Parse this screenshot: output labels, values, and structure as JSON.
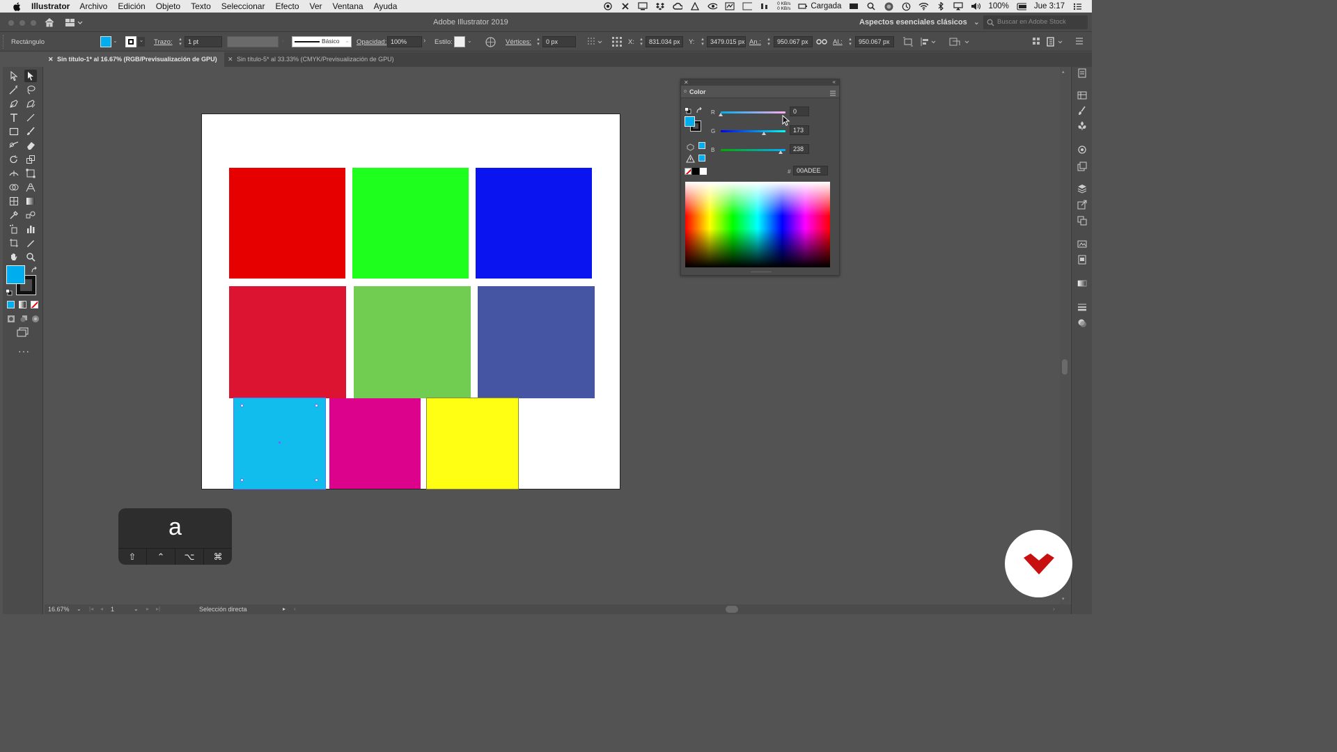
{
  "menubar": {
    "app_name": "Illustrator",
    "items": [
      "Archivo",
      "Edición",
      "Objeto",
      "Texto",
      "Seleccionar",
      "Efecto",
      "Ver",
      "Ventana",
      "Ayuda"
    ],
    "net_up": "0 KB/s",
    "net_down": "0 KB/s",
    "battery_status": "Cargada",
    "battery_pct": "100%",
    "clock": "Jue 3:17"
  },
  "titlebar": {
    "window_title": "Adobe Illustrator 2019",
    "workspace": "Aspectos esenciales clásicos",
    "stock_search_placeholder": "Buscar en Adobe Stock"
  },
  "controlbar": {
    "object_type": "Rectángulo",
    "stroke_label": "Trazo:",
    "stroke_value": "1 pt",
    "brush_label": "Básico",
    "opacity_label": "Opacidad:",
    "opacity_value": "100%",
    "style_label": "Estilo:",
    "vertices_label": "Vértices:",
    "vertices_value": "0 px",
    "x_label": "X:",
    "x_value": "831.034 px",
    "y_label": "Y:",
    "y_value": "3479.015 px",
    "w_label": "An.:",
    "w_value": "950.067 px",
    "h_label": "Al.:",
    "h_value": "950.067 px",
    "fill_color": "#00ADEE"
  },
  "tabs": [
    {
      "label": "Sin título-1* al 16.67% (RGB/Previsualización de GPU)",
      "active": true
    },
    {
      "label": "Sin título-5* al 33.33% (CMYK/Previsualización de GPU)",
      "active": false
    }
  ],
  "artboard": {
    "swatches": [
      {
        "name": "red",
        "color": "#E60000"
      },
      {
        "name": "green",
        "color": "#1EFF1E"
      },
      {
        "name": "blue",
        "color": "#0A14F0"
      },
      {
        "name": "crimson",
        "color": "#DC1432"
      },
      {
        "name": "soft-green",
        "color": "#70CD52"
      },
      {
        "name": "indigo",
        "color": "#4655A3"
      },
      {
        "name": "cyan",
        "color": "#11BDED",
        "selected": true
      },
      {
        "name": "magenta",
        "color": "#DC028C"
      },
      {
        "name": "yellow",
        "color": "#FFFF14"
      }
    ]
  },
  "color_panel": {
    "title": "Color",
    "r_label": "R",
    "r_value": "0",
    "g_label": "G",
    "g_value": "173",
    "b_label": "B",
    "b_value": "238",
    "hex_label": "#",
    "hex_value": "00ADEE"
  },
  "keystroke_overlay": {
    "key": "a",
    "modifiers": [
      "⇧",
      "⌃",
      "⌥",
      "⌘"
    ]
  },
  "statusbar": {
    "zoom": "16.67%",
    "artboard_number": "1",
    "tool_name": "Selección directa"
  }
}
